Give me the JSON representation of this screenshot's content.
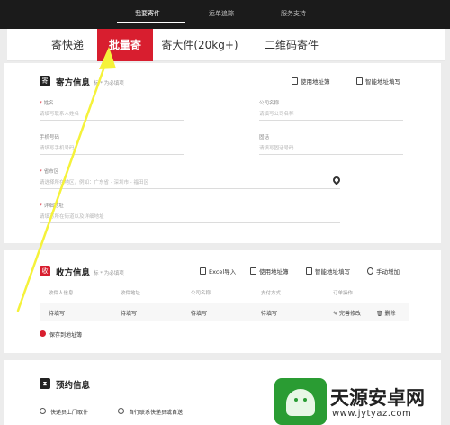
{
  "topbar": {
    "tabs": [
      "我要寄件",
      "运单追踪",
      "服务支持"
    ]
  },
  "ship_tabs": [
    "寄快递",
    "批量寄",
    "寄大件(20kg+)",
    "二维码寄件"
  ],
  "sender": {
    "icon_text": "寄",
    "title": "寄方信息",
    "note": "标 * 为必填项",
    "actions": [
      "使用地址簿",
      "智能地址填写"
    ],
    "fields": {
      "name": {
        "label": "姓名",
        "placeholder": "请填写联系人姓名"
      },
      "company": {
        "label": "公司名称",
        "placeholder": "请填写公司名称"
      },
      "mobile": {
        "label": "手机号码",
        "placeholder": "请填写手机号码"
      },
      "phone": {
        "label": "固话",
        "placeholder": "请填写固话号码"
      },
      "region": {
        "label": "省市区",
        "placeholder": "请选择所在地区，例如：广东省 - 深圳市 - 福田区"
      },
      "address": {
        "label": "详细地址",
        "placeholder": "请填写所在街道以及详细地址"
      }
    }
  },
  "receiver": {
    "icon_text": "收",
    "title": "收方信息",
    "note": "标 * 为必填项",
    "actions": [
      "Excel导入",
      "使用地址簿",
      "智能地址填写",
      "手动增加"
    ],
    "columns": [
      "收件人信息",
      "收件地址",
      "公司名称",
      "支付方式",
      "订单操作"
    ],
    "row": [
      "待填写",
      "待填写",
      "待填写",
      "待填写"
    ],
    "row_actions": [
      "完善修改",
      "删除"
    ],
    "save_label": "保存到地址簿"
  },
  "booking": {
    "title": "预约信息",
    "options": [
      "快递员上门取件",
      "自行联系快递员或自送"
    ]
  },
  "watermark": {
    "title": "天源安卓网",
    "url": "www.jytyaz.com"
  },
  "colors": {
    "brand_red": "#d81e2f",
    "topbar_bg": "#1b1b1b",
    "annotation_arrow": "#f5f23a",
    "watermark_green": "#2a9c33"
  }
}
